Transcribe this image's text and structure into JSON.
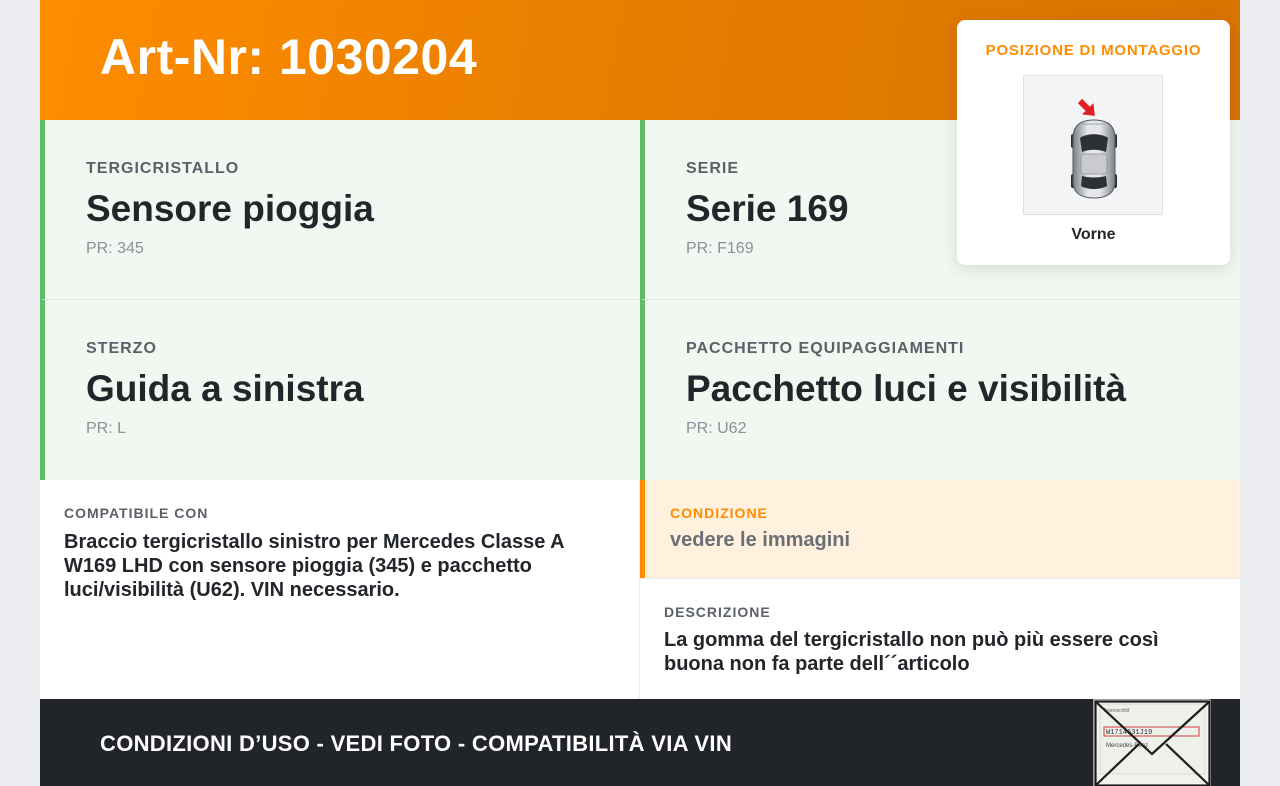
{
  "header": {
    "title": "Art-Nr: 1030204"
  },
  "mounting": {
    "title": "POSIZIONE DI MONTAGGIO",
    "position": "Vorne"
  },
  "specs": [
    {
      "label": "TERGICRISTALLO",
      "value": "Sensore pioggia",
      "pr": "PR: 345"
    },
    {
      "label": "SERIE",
      "value": "Serie 169",
      "pr": "PR: F169"
    },
    {
      "label": "STERZO",
      "value": "Guida a sinistra",
      "pr": "PR: L"
    },
    {
      "label": "PACCHETTO EQUIPAGGIAMENTI",
      "value": "Pacchetto luci e visibilità",
      "pr": "PR: U62"
    }
  ],
  "compatible": {
    "label": "COMPATIBILE CON",
    "text": "Braccio tergicristallo sinistro per Mercedes Classe A W169 LHD con sensore pioggia (345) e pacchetto luci/visibilità (U62). VIN necessario."
  },
  "condition": {
    "label": "CONDIZIONE",
    "text": "vedere le immagini"
  },
  "description": {
    "label": "DESCRIZIONE",
    "text": "La gomma del tergicristallo non può più essere così buona non fa parte dell´´articolo"
  },
  "footer": {
    "text": "CONDIZIONI D’USO - VEDI FOTO - COMPATIBILITÀ VIA VIN",
    "vin_image": {
      "header": "Typenschild",
      "vin": "W1714631J19",
      "brand": "Mercedes-Benz"
    }
  },
  "colors": {
    "accent": "#ff8c00",
    "green": "#5fbb66",
    "dark": "#212429",
    "arrow": "#e02020"
  }
}
